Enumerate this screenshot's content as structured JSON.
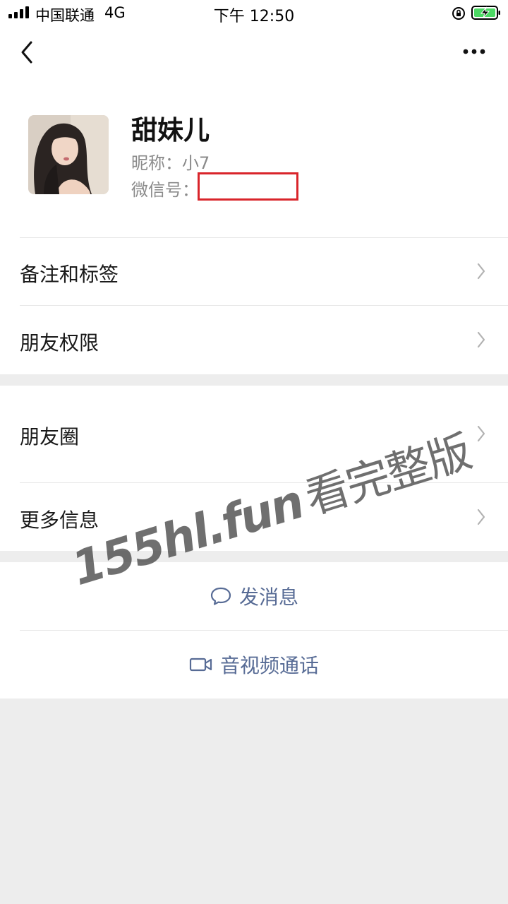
{
  "status_bar": {
    "carrier": "中国联通",
    "network": "4G",
    "time": "下午 12:50"
  },
  "nav": {
    "back_icon": "chevron-left-icon",
    "more_icon": "more-dots-icon"
  },
  "profile": {
    "name": "甜妹儿",
    "nickname": "昵称：小7",
    "wechat_id_label": "微信号："
  },
  "section1": {
    "items": [
      {
        "label": "备注和标签"
      },
      {
        "label": "朋友权限"
      }
    ]
  },
  "section2": {
    "items": [
      {
        "label": "朋友圈"
      },
      {
        "label": "更多信息"
      }
    ]
  },
  "actions": {
    "send_message": "发消息",
    "video_call": "音视频通话"
  },
  "watermark": {
    "domain": "155hl.fun",
    "text": "看完整版"
  },
  "colors": {
    "link_blue": "#576b95",
    "redact_red": "#d9252b",
    "page_bg": "#ededed"
  }
}
